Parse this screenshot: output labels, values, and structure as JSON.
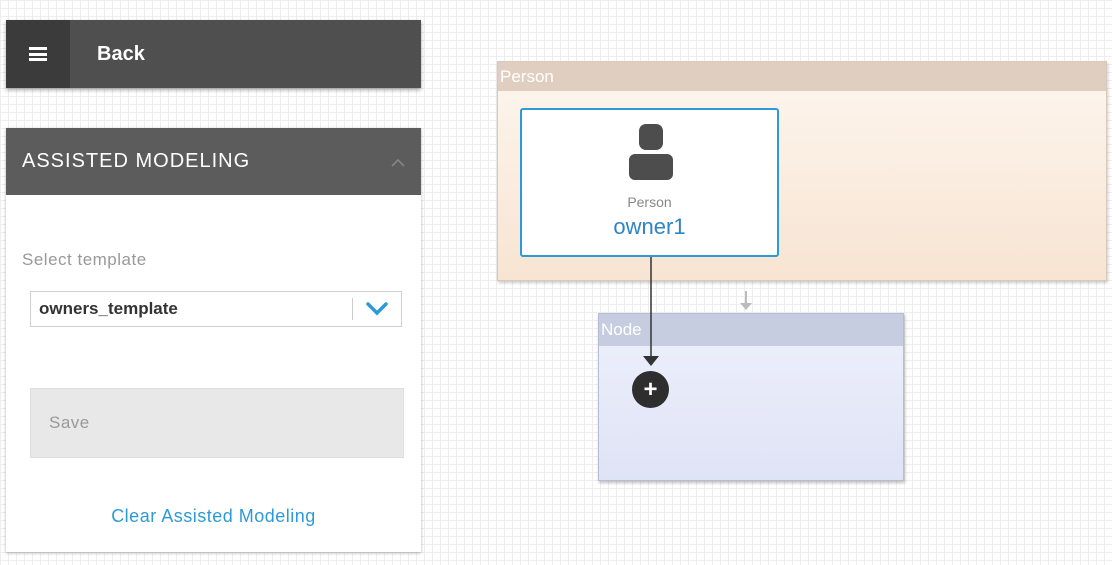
{
  "topbar": {
    "back_label": "Back",
    "menu_icon": "hamburger-icon"
  },
  "panel": {
    "title": "ASSISTED MODELING",
    "select_label": "Select template",
    "select_value": "owners_template",
    "save_label": "Save",
    "clear_label": "Clear Assisted Modeling"
  },
  "canvas": {
    "person_container": {
      "label": "Person"
    },
    "node_container": {
      "label": "Node"
    },
    "card": {
      "type": "Person",
      "name": "owner1"
    },
    "add_icon": "plus-icon"
  },
  "colors": {
    "accent": "#2d9ad8",
    "topbar": "#4f4f4f",
    "panel_header": "#5c5c5c",
    "person_container": "#f8e4d2",
    "node_container": "#dfe3f6"
  }
}
